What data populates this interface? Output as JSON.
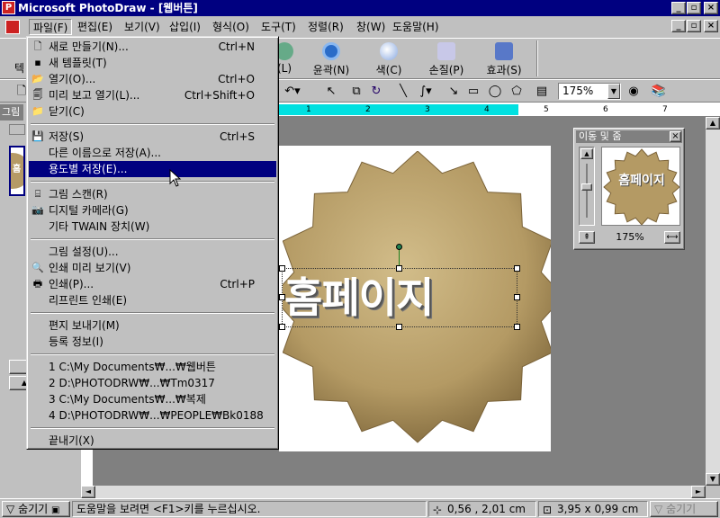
{
  "window": {
    "title": "Microsoft PhotoDraw - [웹버튼]",
    "app_icon": "photodraw-icon"
  },
  "menubar": {
    "items": [
      "파일(F)",
      "편집(E)",
      "보기(V)",
      "삽입(I)",
      "형식(O)",
      "도구(T)",
      "정렬(R)",
      "창(W)",
      "도움말(H)"
    ]
  },
  "visual_toolbar": {
    "partial_left": "텍",
    "items": [
      {
        "label": "(L)",
        "icon": "tool-icon"
      },
      {
        "label": "윤곽(N)",
        "icon": "outline-icon"
      },
      {
        "label": "색(C)",
        "icon": "color-icon"
      },
      {
        "label": "손질(P)",
        "icon": "touchup-icon"
      },
      {
        "label": "효과(S)",
        "icon": "effects-icon"
      }
    ]
  },
  "standard_toolbar": {
    "zoom_value": "175%"
  },
  "left_panel": {
    "tab_label": "그림",
    "thumb_text": "홈"
  },
  "ruler": {
    "ticks": [
      "1",
      "2",
      "3",
      "4",
      "5",
      "6",
      "7"
    ]
  },
  "canvas": {
    "headline": "홈페이지",
    "gear_fill": "#b8a070"
  },
  "navigator": {
    "title": "이동 및 줌",
    "thumb_text": "홈페이지",
    "zoom": "175%"
  },
  "file_menu": {
    "groups": [
      [
        {
          "label": "새로 만들기(N)...",
          "shortcut": "Ctrl+N",
          "icon": "new-icon"
        },
        {
          "label": "새 템플릿(T)",
          "shortcut": "",
          "icon": "template-icon"
        },
        {
          "label": "열기(O)...",
          "shortcut": "Ctrl+O",
          "icon": "open-folder-icon"
        },
        {
          "label": "미리 보고 열기(L)...",
          "shortcut": "Ctrl+Shift+O",
          "icon": "preview-open-icon"
        },
        {
          "label": "닫기(C)",
          "shortcut": "",
          "icon": "close-folder-icon"
        }
      ],
      [
        {
          "label": "저장(S)",
          "shortcut": "Ctrl+S",
          "icon": "save-icon"
        },
        {
          "label": "다른 이름으로 저장(A)...",
          "shortcut": "",
          "icon": ""
        },
        {
          "label": "용도별 저장(E)...",
          "shortcut": "",
          "icon": "",
          "highlight": true
        }
      ],
      [
        {
          "label": "그림 스캔(R)",
          "shortcut": "",
          "icon": "scanner-icon"
        },
        {
          "label": "디지털 카메라(G)",
          "shortcut": "",
          "icon": "camera-icon"
        },
        {
          "label": "기타 TWAIN 장치(W)",
          "shortcut": "",
          "icon": ""
        }
      ],
      [
        {
          "label": "그림 설정(U)...",
          "shortcut": "",
          "icon": ""
        },
        {
          "label": "인쇄 미리 보기(V)",
          "shortcut": "",
          "icon": "print-preview-icon"
        },
        {
          "label": "인쇄(P)...",
          "shortcut": "Ctrl+P",
          "icon": "print-icon"
        },
        {
          "label": "리프린트 인쇄(E)",
          "shortcut": "",
          "icon": ""
        }
      ],
      [
        {
          "label": "편지 보내기(M)",
          "shortcut": "",
          "icon": ""
        },
        {
          "label": "등록 정보(I)",
          "shortcut": "",
          "icon": ""
        }
      ],
      [
        {
          "label": "1 C:\\My Documents₩...₩웹버튼",
          "shortcut": "",
          "icon": ""
        },
        {
          "label": "2 D:\\PHOTODRW₩...₩Tm0317",
          "shortcut": "",
          "icon": ""
        },
        {
          "label": "3 C:\\My Documents₩...₩복제",
          "shortcut": "",
          "icon": ""
        },
        {
          "label": "4 D:\\PHOTODRW₩...₩PEOPLE₩Bk0188",
          "shortcut": "",
          "icon": ""
        }
      ],
      [
        {
          "label": "끝내기(X)",
          "shortcut": "",
          "icon": ""
        }
      ]
    ]
  },
  "statusbar": {
    "hide_left": "숨기기",
    "help_text": "도움말을 보려면 <F1>키를 누르십시오.",
    "position": "0,56 , 2,01 cm",
    "size": "3,95 x 0,99 cm",
    "hide_right": "숨기기"
  }
}
